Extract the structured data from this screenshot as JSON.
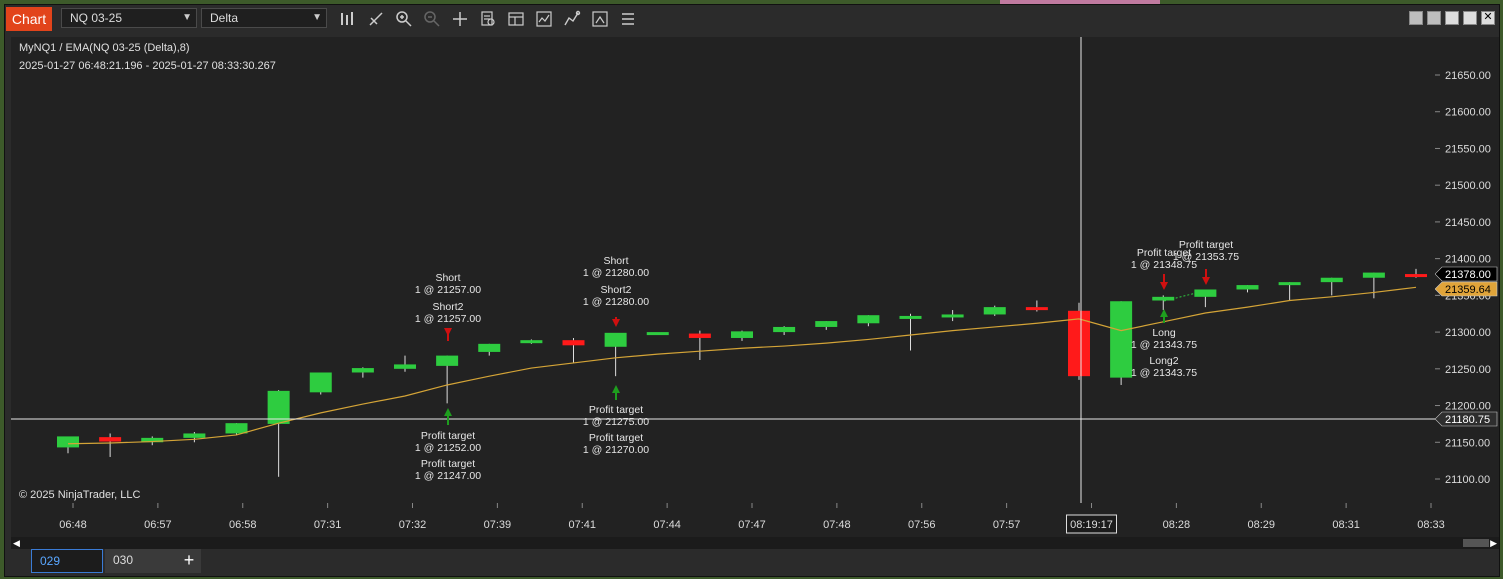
{
  "toolbar": {
    "chart_tab": "Chart",
    "instrument": "NQ 03-25",
    "bar_type": "Delta",
    "icons": [
      "bar-style-icon",
      "draw-tool-icon",
      "zoom-in-icon",
      "zoom-out-icon",
      "crosshair-icon",
      "data-box-icon",
      "properties-icon",
      "indicators-icon",
      "strategies-icon",
      "snapshot-icon",
      "menu-icon"
    ]
  },
  "chart": {
    "title": "MyNQ1 / EMA(NQ 03-25 (Delta),8)",
    "range": "2025-01-27 06:48:21.196 - 2025-01-27 08:33:30.267",
    "copyright": "© 2025 NinjaTrader, LLC",
    "price_ticks": [
      "21650.00",
      "21600.00",
      "21550.00",
      "21500.00",
      "21450.00",
      "21400.00",
      "21350.00",
      "21300.00",
      "21250.00",
      "21200.00",
      "21150.00",
      "21100.00"
    ],
    "time_ticks": [
      "06:48",
      "06:57",
      "06:58",
      "07:31",
      "07:32",
      "07:39",
      "07:41",
      "07:44",
      "07:47",
      "07:48",
      "07:56",
      "07:57",
      "08:19:17",
      "08:28",
      "08:29",
      "08:31",
      "08:33"
    ],
    "last_price": "21378.00",
    "ema_price": "21359.64",
    "crosshair_price": "21180.75",
    "crosshair_time": "08:19:17",
    "colors": {
      "up": "#2ecc40",
      "down": "#ff1a1a",
      "ema": "#d4a437",
      "last": "#000000",
      "ema_tag": "#e0a43a"
    },
    "annotations": {
      "short_a": "Short",
      "short_a_fill": "1 @ 21257.00",
      "short2_a": "Short2",
      "short2_a_fill": "1 @ 21257.00",
      "pt_a1": "Profit target",
      "pt_a1_fill": "1 @ 21252.00",
      "pt_a2": "Profit target",
      "pt_a2_fill": "1 @ 21247.00",
      "short_b": "Short",
      "short_b_fill": "1 @ 21280.00",
      "short2_b": "Short2",
      "short2_b_fill": "1 @ 21280.00",
      "pt_b1": "Profit target",
      "pt_b1_fill": "1 @ 21275.00",
      "pt_b2": "Profit target",
      "pt_b2_fill": "1 @ 21270.00",
      "pt_c1": "Profit target",
      "pt_c1_fill": "1 @ 21348.75",
      "pt_c2": "Profit target",
      "pt_c2_fill": "1 @ 21353.75",
      "long_c": "Long",
      "long_c_fill": "1 @ 21343.75",
      "long2_c": "Long2",
      "long2_c_fill": "1 @ 21343.75"
    }
  },
  "chart_data": {
    "type": "candlestick",
    "ylim": [
      21080,
      21705
    ],
    "categories": [
      "06:48",
      "06:57",
      "06:58",
      "07:31",
      "07:32",
      "07:39",
      "07:41",
      "07:44",
      "07:47",
      "07:48",
      "07:56",
      "07:57",
      "08:19:17",
      "08:28",
      "08:29",
      "08:31",
      "08:33"
    ],
    "candles": [
      {
        "o": 21143,
        "h": 21152,
        "l": 21135,
        "c": 21158,
        "dir": "up"
      },
      {
        "o": 21157,
        "h": 21162,
        "l": 21130,
        "c": 21151,
        "dir": "down"
      },
      {
        "o": 21150,
        "h": 21158,
        "l": 21146,
        "c": 21156,
        "dir": "up"
      },
      {
        "o": 21156,
        "h": 21164,
        "l": 21150,
        "c": 21162,
        "dir": "up"
      },
      {
        "o": 21162,
        "h": 21176,
        "l": 21160,
        "c": 21176,
        "dir": "up"
      },
      {
        "o": 21175,
        "h": 21221,
        "l": 21103,
        "c": 21220,
        "dir": "up"
      },
      {
        "o": 21218,
        "h": 21245,
        "l": 21215,
        "c": 21245,
        "dir": "up"
      },
      {
        "o": 21245,
        "h": 21252,
        "l": 21238,
        "c": 21251,
        "dir": "up"
      },
      {
        "o": 21250,
        "h": 21268,
        "l": 21246,
        "c": 21256,
        "dir": "up"
      },
      {
        "o": 21254,
        "h": 21268,
        "l": 21203,
        "c": 21268,
        "dir": "up"
      },
      {
        "o": 21273,
        "h": 21284,
        "l": 21268,
        "c": 21284,
        "dir": "up"
      },
      {
        "o": 21286,
        "h": 21290,
        "l": 21284,
        "c": 21289,
        "dir": "up"
      },
      {
        "o": 21289,
        "h": 21292,
        "l": 21258,
        "c": 21282,
        "dir": "down"
      },
      {
        "o": 21280,
        "h": 21295,
        "l": 21240,
        "c": 21299,
        "dir": "up"
      },
      {
        "o": 21300,
        "h": 21300,
        "l": 21300,
        "c": 21300,
        "dir": "up"
      },
      {
        "o": 21298,
        "h": 21302,
        "l": 21262,
        "c": 21292,
        "dir": "down"
      },
      {
        "o": 21292,
        "h": 21302,
        "l": 21288,
        "c": 21301,
        "dir": "up"
      },
      {
        "o": 21300,
        "h": 21308,
        "l": 21296,
        "c": 21307,
        "dir": "up"
      },
      {
        "o": 21307,
        "h": 21315,
        "l": 21303,
        "c": 21315,
        "dir": "up"
      },
      {
        "o": 21312,
        "h": 21323,
        "l": 21308,
        "c": 21323,
        "dir": "up"
      },
      {
        "o": 21322,
        "h": 21325,
        "l": 21275,
        "c": 21322,
        "dir": "up"
      },
      {
        "o": 21322,
        "h": 21330,
        "l": 21315,
        "c": 21324,
        "dir": "up"
      },
      {
        "o": 21324,
        "h": 21336,
        "l": 21322,
        "c": 21334,
        "dir": "up"
      },
      {
        "o": 21334,
        "h": 21343,
        "l": 21328,
        "c": 21330,
        "dir": "down"
      },
      {
        "o": 21329,
        "h": 21340,
        "l": 21235,
        "c": 21240,
        "dir": "down"
      },
      {
        "o": 21238,
        "h": 21342,
        "l": 21228,
        "c": 21342,
        "dir": "up"
      },
      {
        "o": 21343,
        "h": 21350,
        "l": 21330,
        "c": 21348,
        "dir": "up"
      },
      {
        "o": 21348,
        "h": 21358,
        "l": 21334,
        "c": 21358,
        "dir": "up"
      },
      {
        "o": 21358,
        "h": 21364,
        "l": 21354,
        "c": 21364,
        "dir": "up"
      },
      {
        "o": 21364,
        "h": 21368,
        "l": 21343,
        "c": 21368,
        "dir": "up"
      },
      {
        "o": 21368,
        "h": 21374,
        "l": 21350,
        "c": 21374,
        "dir": "up"
      },
      {
        "o": 21374,
        "h": 21381,
        "l": 21346,
        "c": 21381,
        "dir": "up"
      },
      {
        "o": 21379,
        "h": 21386,
        "l": 21374,
        "c": 21375,
        "dir": "down"
      }
    ],
    "ema": [
      21148,
      21149,
      21151,
      21154,
      21160,
      21176,
      21190,
      21202,
      21213,
      21228,
      21240,
      21251,
      21258,
      21265,
      21270,
      21274,
      21278,
      21281,
      21285,
      21290,
      21296,
      21302,
      21307,
      21312,
      21318,
      21302,
      21314,
      21326,
      21334,
      21343,
      21348,
      21354,
      21361
    ]
  },
  "scrollbar": {
    "left": "◀",
    "right": "▶"
  },
  "tabs": {
    "tab1": "029",
    "tab2": "030",
    "add": "+"
  }
}
